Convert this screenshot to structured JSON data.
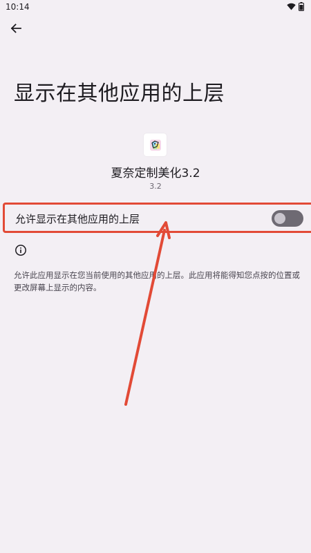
{
  "status_bar": {
    "time": "10:14",
    "icons": [
      "wifi-icon",
      "battery-icon"
    ]
  },
  "header": {
    "back_icon": "arrow-back-icon",
    "title": "显示在其他应用的上层"
  },
  "app": {
    "icon": "app-logo-icon",
    "name": "夏奈定制美化3.2",
    "version": "3.2"
  },
  "setting": {
    "label": "允许显示在其他应用的上层",
    "enabled": false
  },
  "info": {
    "icon": "info-icon",
    "text": "允许此应用显示在您当前使用的其他应用的上层。此应用将能得知您点按的位置或更改屏幕上显示的内容。"
  },
  "colors": {
    "background": "#f3eff4",
    "highlight": "#e24a36",
    "switch_track_off": "#6e6a73",
    "switch_thumb_off": "#c9c5cd"
  }
}
